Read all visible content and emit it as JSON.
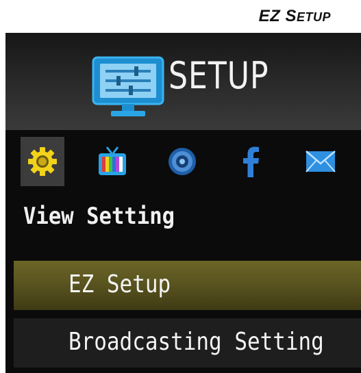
{
  "page_heading": {
    "title_prefix": "EZ S",
    "title_suffix": "ETUP"
  },
  "header": {
    "title": "SETUP",
    "icon": "monitor-settings-icon"
  },
  "category_icons": [
    {
      "name": "gear-icon",
      "selected": true
    },
    {
      "name": "tv-icon",
      "selected": false
    },
    {
      "name": "speaker-icon",
      "selected": false
    },
    {
      "name": "facebook-icon",
      "selected": false
    },
    {
      "name": "mail-icon",
      "selected": false
    }
  ],
  "section": {
    "title": "View Setting"
  },
  "menu": {
    "items": [
      {
        "label": "EZ Setup",
        "active": true
      },
      {
        "label": "Broadcasting Setting",
        "active": false
      }
    ]
  },
  "colors": {
    "background": "#0b0b0b",
    "active_item": "#5a5420",
    "accent_blue": "#29a3e3",
    "gear_yellow": "#f2d21a"
  }
}
